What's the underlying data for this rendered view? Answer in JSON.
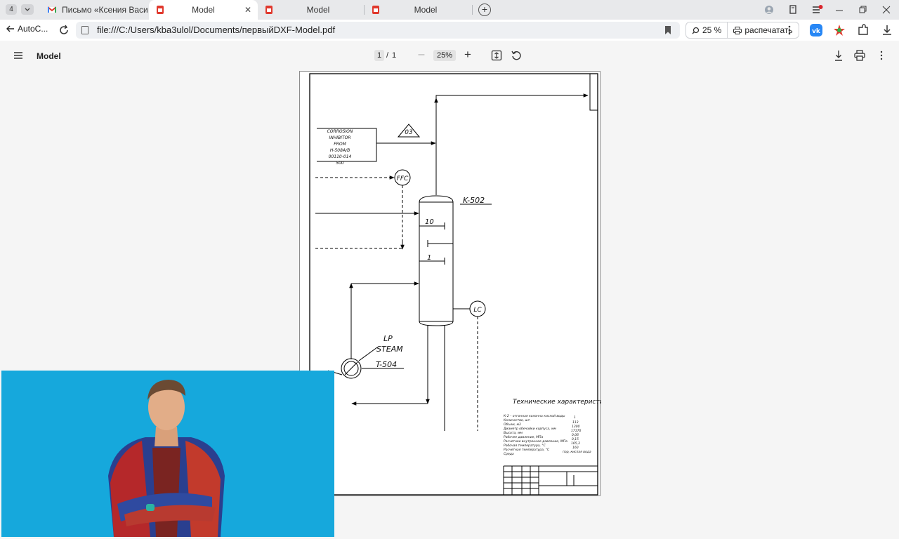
{
  "tabbar": {
    "tab_count": "4",
    "tabs": [
      {
        "title": "Письмо «Ксения Васильева",
        "active": false
      },
      {
        "title": "Model",
        "active": true
      },
      {
        "title": "Model",
        "active": false
      },
      {
        "title": "Model",
        "active": false
      }
    ]
  },
  "addressbar": {
    "back_label": "AutoC...",
    "url": "file:///C:/Users/kba3ulol/Documents/первыйDXF-Model.pdf",
    "zoom": "25 %",
    "print_label": "распечатать"
  },
  "pdf_toolbar": {
    "title": "Model",
    "current_page": "1",
    "page_separator": "/",
    "total_pages": "1",
    "zoom": "25%"
  },
  "drawing": {
    "labels": {
      "corrosion": [
        "CORROSION",
        "INHIBITOR",
        "FROM",
        "H-508A/B",
        "00110-014",
        "500"
      ],
      "marker_03": "03",
      "ffc": "FFC",
      "column_tag": "K-502",
      "tray_top": "10",
      "tray_bottom": "1",
      "lc": "LC",
      "lp": "LP",
      "steam": "STEAM",
      "exchanger_tag": "T-504",
      "tech_title": "Технические характеристики",
      "tech_rows": [
        "К-2 – отгонная колонна кислой воды",
        "Количество, шт.",
        "Объем, м3",
        "Диаметр обечайки корпуса, мм",
        "Высота, мм",
        "Рабочее давление, МПа",
        "Расчетное внутреннее давление, МПа",
        "Рабочая температура, °С",
        "Расчетная температура, °С",
        "Среда"
      ],
      "tech_values": [
        "1",
        "113",
        "1300",
        "17170",
        "0,06",
        "0,15",
        "105,3",
        "160",
        "пар, кислая вода"
      ]
    }
  },
  "colors": {
    "tab_strip": "#e8e9eb",
    "toolbar_bg": "#f5f5f5",
    "video_bg": "#16a8dc",
    "notification_dot": "#d9242b"
  }
}
